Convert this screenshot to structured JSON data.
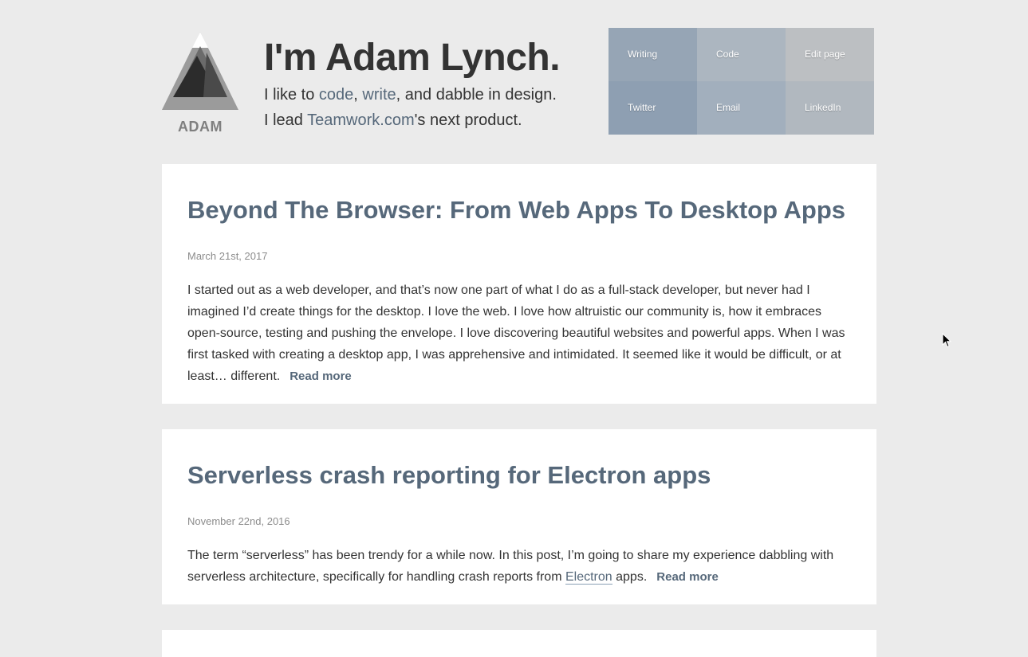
{
  "header": {
    "logo_text": "ADAM",
    "title": "I'm Adam Lynch.",
    "line1": {
      "prefix": "I like to ",
      "link_code": "code",
      "sep": ", ",
      "link_write": "write",
      "suffix": ", and dabble in design."
    },
    "line2": {
      "prefix": "I lead ",
      "link_teamwork": "Teamwork.com",
      "suffix": "'s next product."
    }
  },
  "nav": {
    "items": [
      {
        "label": "Writing",
        "color": "#96a5b5"
      },
      {
        "label": "Code",
        "color": "#acb6c0"
      },
      {
        "label": "Edit page",
        "color": "#bcbfc2"
      },
      {
        "label": "Twitter",
        "color": "#8e9fb2"
      },
      {
        "label": "Email",
        "color": "#a2afbd"
      },
      {
        "label": "LinkedIn",
        "color": "#b1b8bf"
      }
    ]
  },
  "posts": [
    {
      "title": "Beyond The Browser: From Web Apps To Desktop Apps",
      "date": "March 21st, 2017",
      "excerpt": "I started out as a web developer, and that’s now one part of what I do as a full-stack developer, but never had I imagined I’d create things for the desktop. I love the web. I love how altruistic our community is, how it embraces open-source, testing and pushing the envelope. I love discovering beautiful websites and powerful apps. When I was first tasked with creating a desktop app, I was apprehensive and intimidated. It seemed like it would be difficult, or at least… different.",
      "read_more": "Read more"
    },
    {
      "title": "Serverless crash reporting for Electron apps",
      "date": "November 22nd, 2016",
      "excerpt_prefix": "The term “serverless” has been trendy for a while now. In this post, I’m going to share my experience dabbling with serverless architecture, specifically for handling crash reports from ",
      "excerpt_link": "Electron",
      "excerpt_suffix": " apps.",
      "read_more": "Read more"
    }
  ],
  "colors": {
    "background": "#ebebeb",
    "accent": "#56687a",
    "text": "#333333",
    "muted": "#8c8c8c"
  }
}
